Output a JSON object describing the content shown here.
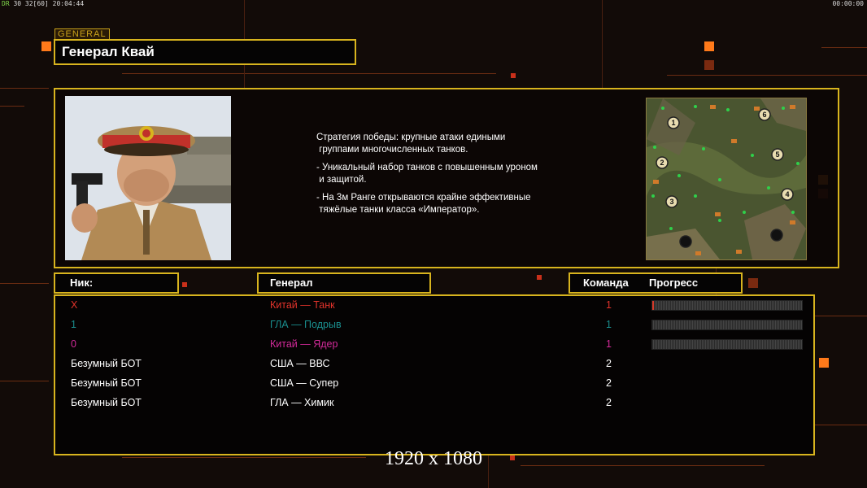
{
  "hud": {
    "left_prefix": "DR",
    "left_text": "30 32[60] 20:04:44",
    "right_text": "00:00:00"
  },
  "general_tag": "GENERAL",
  "general_name": "Генерал Квай",
  "description": [
    "Стратегия победы: крупные атаки едиными\n группами многочисленных танков.",
    "- Уникальный набор танков с повышенным уроном\n и защитой.",
    "- На 3м Ранге открываются крайне эффективные\n тяжёлые танки класса «Император»."
  ],
  "minimap": {
    "start_numbers": [
      "1",
      "2",
      "3",
      "4",
      "5",
      "6"
    ]
  },
  "columns": {
    "nick": "Ник:",
    "general": "Генерал",
    "team": "Команда",
    "progress": "Прогресс"
  },
  "players": [
    {
      "nick": "X",
      "general": "Китай — Танк",
      "team": "1",
      "color": "#e2332b",
      "progress": 0.01,
      "show_progress": true
    },
    {
      "nick": "1",
      "general": "ГЛА — Подрыв",
      "team": "1",
      "color": "#1a8f8f",
      "progress": 0.0,
      "show_progress": true
    },
    {
      "nick": "0",
      "general": "Китай — Ядер",
      "team": "1",
      "color": "#d32a9a",
      "progress": 0.0,
      "show_progress": true
    },
    {
      "nick": "Безумный БОТ",
      "general": "США — ВВС",
      "team": "2",
      "color": "#ffffff",
      "show_progress": false
    },
    {
      "nick": "Безумный БОТ",
      "general": "США — Супер",
      "team": "2",
      "color": "#ffffff",
      "show_progress": false
    },
    {
      "nick": "Безумный БОТ",
      "general": "ГЛА — Химик",
      "team": "2",
      "color": "#ffffff",
      "show_progress": false
    }
  ],
  "resolution_label": "1920 x 1080"
}
